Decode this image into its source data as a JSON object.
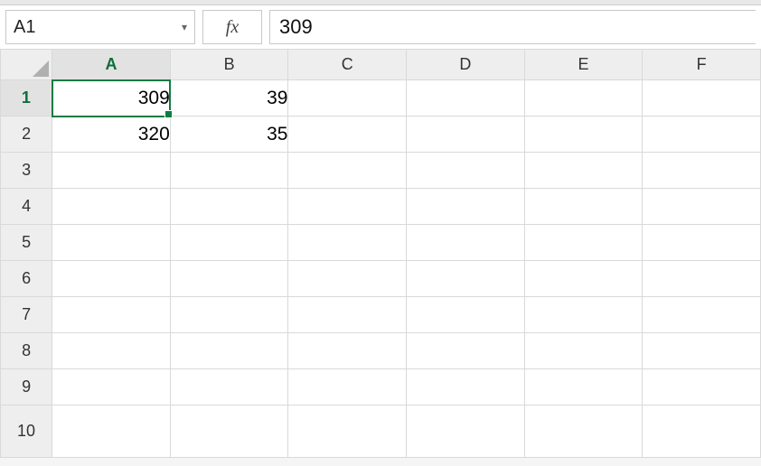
{
  "formula_bar": {
    "cell_ref": "A1",
    "fx_label": "fx",
    "formula_value": "309"
  },
  "columns": [
    "A",
    "B",
    "C",
    "D",
    "E",
    "F"
  ],
  "rows": [
    "1",
    "2",
    "3",
    "4",
    "5",
    "6",
    "7",
    "8",
    "9",
    "10"
  ],
  "active_col_index": 0,
  "active_row_index": 0,
  "cells": {
    "A1": "309",
    "B1": "39",
    "A2": "320",
    "B2": "35"
  },
  "selected_cell": "A1",
  "chart_data": {
    "type": "table",
    "columns": [
      "A",
      "B"
    ],
    "rows": [
      [
        309,
        39
      ],
      [
        320,
        35
      ]
    ]
  }
}
